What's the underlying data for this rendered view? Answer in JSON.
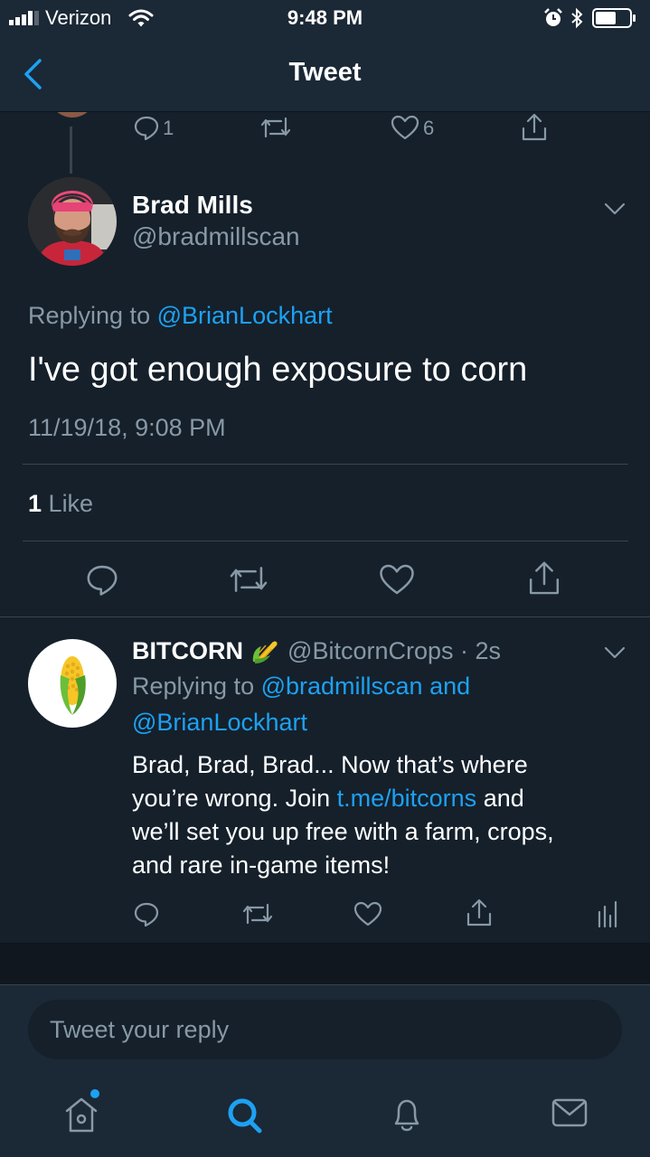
{
  "status_bar": {
    "carrier": "Verizon",
    "time": "9:48 PM"
  },
  "nav": {
    "title": "Tweet"
  },
  "previous_tweet_actions": {
    "reply_count": "1",
    "like_count": "6"
  },
  "main_tweet": {
    "display_name": "Brad Mills",
    "handle": "@bradmillscan",
    "replying_prefix": "Replying to",
    "replying_to": "@BrianLockhart",
    "text": "I've got enough exposure to corn",
    "timestamp": "11/19/18, 9:08 PM",
    "likes_count": "1",
    "likes_label": "Like"
  },
  "reply_tweet": {
    "display_name": "BITCORN",
    "emoji": "🌽",
    "handle": "@BitcornCrops",
    "separator": "·",
    "age": "2s",
    "replying_prefix": "Replying to",
    "replying_to_line1": "@bradmillscan and",
    "replying_to_line2": "@BrianLockhart",
    "text_line1": "Brad, Brad, Brad... Now that’s where",
    "text_line2_a": "you’re wrong. Join ",
    "text_line2_link": "t.me/bitcorns",
    "text_line2_b": " and",
    "text_line3": "we’ll set you up free with a farm, crops,",
    "text_line4": "and rare in-game items!"
  },
  "compose": {
    "placeholder": "Tweet your reply"
  },
  "tab_bar": {
    "items": [
      "home-icon",
      "search-icon",
      "notifications-icon",
      "messages-icon"
    ]
  },
  "colors": {
    "background": "#15202b",
    "bar": "#1b2836",
    "accent": "#1da1f2",
    "muted": "#8899a6",
    "divider": "#38444d"
  }
}
